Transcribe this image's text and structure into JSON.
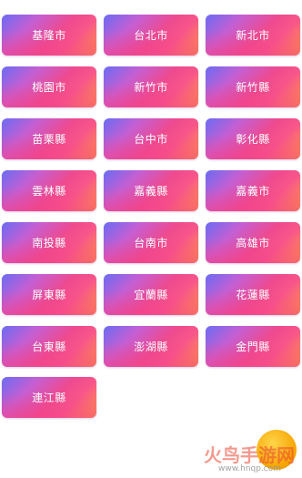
{
  "cities": [
    "基隆市",
    "台北市",
    "新北市",
    "桃園市",
    "新竹市",
    "新竹縣",
    "苗栗縣",
    "台中市",
    "彰化縣",
    "雲林縣",
    "嘉義縣",
    "嘉義市",
    "南投縣",
    "台南市",
    "高雄市",
    "屏東縣",
    "宜蘭縣",
    "花蓮縣",
    "台東縣",
    "澎湖縣",
    "金門縣",
    "連江縣"
  ],
  "watermark": {
    "text": "火鸟手游网",
    "url": "www.hnqp.com"
  },
  "colors": {
    "gradient_start": "#6a6cf2",
    "gradient_mid": "#ee4a8f",
    "gradient_end": "#fda03b",
    "label": "#ffffff"
  }
}
